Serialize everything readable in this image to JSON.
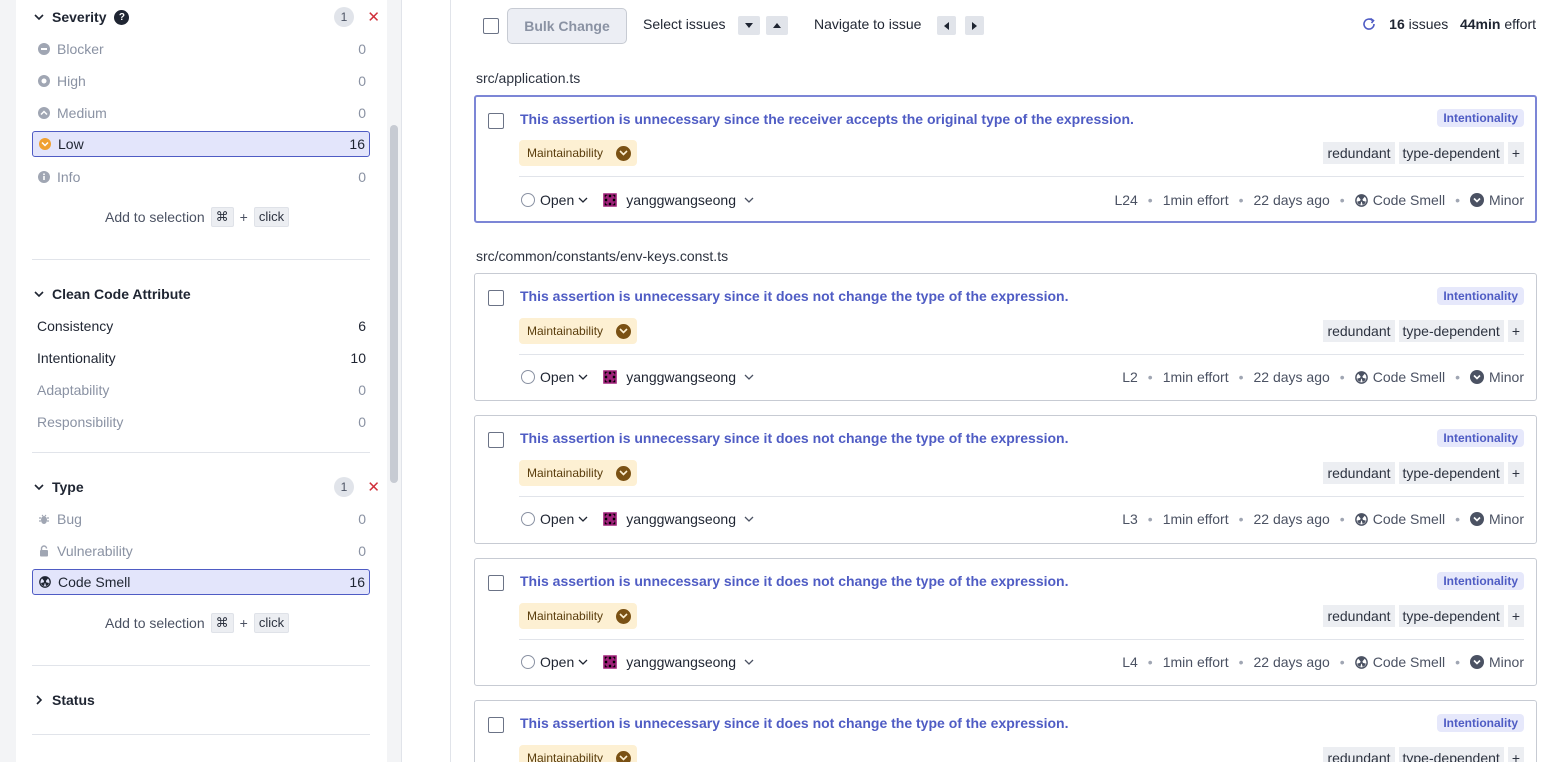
{
  "sidebar": {
    "severity": {
      "title": "Severity",
      "count": "1",
      "items": [
        {
          "label": "Blocker",
          "count": "0"
        },
        {
          "label": "High",
          "count": "0"
        },
        {
          "label": "Medium",
          "count": "0"
        },
        {
          "label": "Low",
          "count": "16"
        },
        {
          "label": "Info",
          "count": "0"
        }
      ],
      "hint": {
        "text": "Add to selection",
        "key": "⌘",
        "plus": "+",
        "click": "click"
      }
    },
    "clean_code": {
      "title": "Clean Code Attribute",
      "items": [
        {
          "label": "Consistency",
          "count": "6"
        },
        {
          "label": "Intentionality",
          "count": "10"
        },
        {
          "label": "Adaptability",
          "count": "0"
        },
        {
          "label": "Responsibility",
          "count": "0"
        }
      ]
    },
    "type": {
      "title": "Type",
      "count": "1",
      "items": [
        {
          "label": "Bug",
          "count": "0"
        },
        {
          "label": "Vulnerability",
          "count": "0"
        },
        {
          "label": "Code Smell",
          "count": "16"
        }
      ],
      "hint": {
        "text": "Add to selection",
        "key": "⌘",
        "plus": "+",
        "click": "click"
      }
    },
    "status": {
      "title": "Status"
    }
  },
  "toolbar": {
    "bulk_change": "Bulk Change",
    "select_issues": "Select issues",
    "navigate": "Navigate to issue",
    "issues_count": "16",
    "issues_label": "issues",
    "effort": "44min",
    "effort_label": "effort"
  },
  "files": [
    "src/application.ts",
    "src/common/constants/env-keys.const.ts"
  ],
  "issues": [
    {
      "title": "This assertion is unnecessary since the receiver accepts the original type of the expression.",
      "attribute": "Intentionality",
      "quality": "Maintainability",
      "tags": [
        "redundant",
        "type-dependent",
        "+"
      ],
      "status": "Open",
      "assignee": "yanggwangseong",
      "line": "L24",
      "effort": "1min effort",
      "age": "22 days ago",
      "type": "Code Smell",
      "severity": "Minor"
    },
    {
      "title": "This assertion is unnecessary since it does not change the type of the expression.",
      "attribute": "Intentionality",
      "quality": "Maintainability",
      "tags": [
        "redundant",
        "type-dependent",
        "+"
      ],
      "status": "Open",
      "assignee": "yanggwangseong",
      "line": "L2",
      "effort": "1min effort",
      "age": "22 days ago",
      "type": "Code Smell",
      "severity": "Minor"
    },
    {
      "title": "This assertion is unnecessary since it does not change the type of the expression.",
      "attribute": "Intentionality",
      "quality": "Maintainability",
      "tags": [
        "redundant",
        "type-dependent",
        "+"
      ],
      "status": "Open",
      "assignee": "yanggwangseong",
      "line": "L3",
      "effort": "1min effort",
      "age": "22 days ago",
      "type": "Code Smell",
      "severity": "Minor"
    },
    {
      "title": "This assertion is unnecessary since it does not change the type of the expression.",
      "attribute": "Intentionality",
      "quality": "Maintainability",
      "tags": [
        "redundant",
        "type-dependent",
        "+"
      ],
      "status": "Open",
      "assignee": "yanggwangseong",
      "line": "L4",
      "effort": "1min effort",
      "age": "22 days ago",
      "type": "Code Smell",
      "severity": "Minor"
    },
    {
      "title": "This assertion is unnecessary since it does not change the type of the expression.",
      "attribute": "Intentionality",
      "quality": "Maintainability",
      "tags": [
        "redundant",
        "type-dependent",
        "+"
      ]
    }
  ],
  "colors": {
    "accent": "#4f5cc4",
    "selected_bg": "#e3e5fb",
    "remove": "#d02f3a",
    "impact_bg": "#fdf0d3"
  },
  "icons": {
    "severity": [
      "blocker-icon",
      "high-icon",
      "medium-icon",
      "low-icon",
      "info-icon"
    ],
    "type": [
      "bug-icon",
      "lock-icon",
      "code-smell-icon"
    ]
  }
}
